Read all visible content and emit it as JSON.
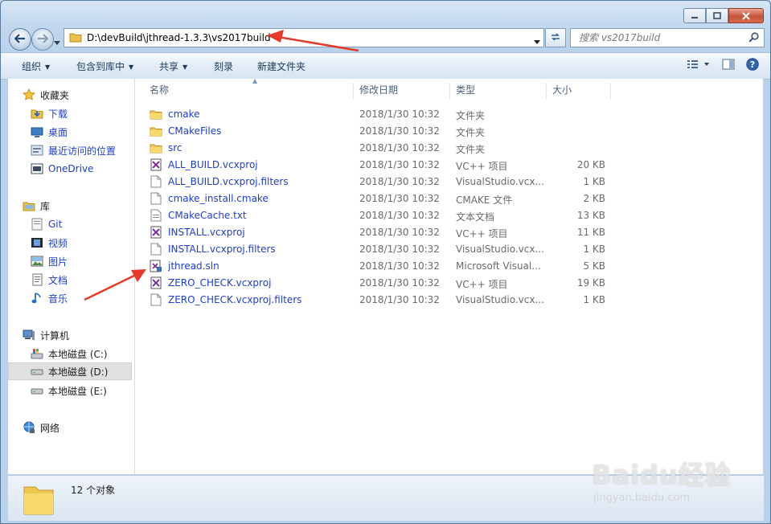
{
  "window": {
    "caption_buttons": [
      "minimize-icon",
      "maximize-icon",
      "close-icon"
    ]
  },
  "nav": {
    "address_path": "D:\\devBuild\\jthread-1.3.3\\vs2017build",
    "search_placeholder": "搜索 vs2017build"
  },
  "toolbar": {
    "organize": "组织",
    "include_in_library": "包含到库中",
    "share": "共享",
    "burn": "刻录",
    "new_folder": "新建文件夹"
  },
  "sidebar": {
    "favorites": {
      "label": "收藏夹",
      "items": [
        {
          "label": "下载",
          "icon": "download-folder-icon"
        },
        {
          "label": "桌面",
          "icon": "desktop-icon"
        },
        {
          "label": "最近访问的位置",
          "icon": "recent-places-icon"
        },
        {
          "label": "OneDrive",
          "icon": "onedrive-icon"
        }
      ]
    },
    "libraries": {
      "label": "库",
      "items": [
        {
          "label": "Git",
          "icon": "git-library-icon"
        },
        {
          "label": "视频",
          "icon": "video-library-icon"
        },
        {
          "label": "图片",
          "icon": "pictures-library-icon"
        },
        {
          "label": "文档",
          "icon": "documents-library-icon"
        },
        {
          "label": "音乐",
          "icon": "music-library-icon"
        }
      ]
    },
    "computer": {
      "label": "计算机",
      "items": [
        {
          "label": "本地磁盘 (C:)",
          "icon": "system-drive-icon"
        },
        {
          "label": "本地磁盘 (D:)",
          "icon": "drive-icon",
          "selected": true
        },
        {
          "label": "本地磁盘 (E:)",
          "icon": "drive-icon"
        }
      ]
    },
    "network": {
      "label": "网络"
    }
  },
  "columns": {
    "name": "名称",
    "date": "修改日期",
    "type": "类型",
    "size": "大小"
  },
  "files": [
    {
      "name": "cmake",
      "date": "2018/1/30 10:32",
      "type": "文件夹",
      "size": "",
      "icon": "folder-icon"
    },
    {
      "name": "CMakeFiles",
      "date": "2018/1/30 10:32",
      "type": "文件夹",
      "size": "",
      "icon": "folder-icon"
    },
    {
      "name": "src",
      "date": "2018/1/30 10:32",
      "type": "文件夹",
      "size": "",
      "icon": "folder-icon"
    },
    {
      "name": "ALL_BUILD.vcxproj",
      "date": "2018/1/30 10:32",
      "type": "VC++ 项目",
      "size": "20 KB",
      "icon": "vcxproj-icon"
    },
    {
      "name": "ALL_BUILD.vcxproj.filters",
      "date": "2018/1/30 10:32",
      "type": "VisualStudio.vcx...",
      "size": "1 KB",
      "icon": "file-icon"
    },
    {
      "name": "cmake_install.cmake",
      "date": "2018/1/30 10:32",
      "type": "CMAKE 文件",
      "size": "2 KB",
      "icon": "file-icon"
    },
    {
      "name": "CMakeCache.txt",
      "date": "2018/1/30 10:32",
      "type": "文本文档",
      "size": "13 KB",
      "icon": "text-file-icon"
    },
    {
      "name": "INSTALL.vcxproj",
      "date": "2018/1/30 10:32",
      "type": "VC++ 项目",
      "size": "11 KB",
      "icon": "vcxproj-icon"
    },
    {
      "name": "INSTALL.vcxproj.filters",
      "date": "2018/1/30 10:32",
      "type": "VisualStudio.vcx...",
      "size": "1 KB",
      "icon": "file-icon"
    },
    {
      "name": "jthread.sln",
      "date": "2018/1/30 10:32",
      "type": "Microsoft Visual...",
      "size": "5 KB",
      "icon": "sln-icon"
    },
    {
      "name": "ZERO_CHECK.vcxproj",
      "date": "2018/1/30 10:32",
      "type": "VC++ 项目",
      "size": "19 KB",
      "icon": "vcxproj-icon"
    },
    {
      "name": "ZERO_CHECK.vcxproj.filters",
      "date": "2018/1/30 10:32",
      "type": "VisualStudio.vcx...",
      "size": "1 KB",
      "icon": "file-icon"
    }
  ],
  "status": {
    "count": "12 个对象"
  },
  "watermark": {
    "brand": "Baidu经验",
    "url": "jingyan.baidu.com"
  },
  "colors": {
    "link": "#1e3ecc",
    "arrow": "#e8382c",
    "toolbar_text": "#1e395b"
  }
}
